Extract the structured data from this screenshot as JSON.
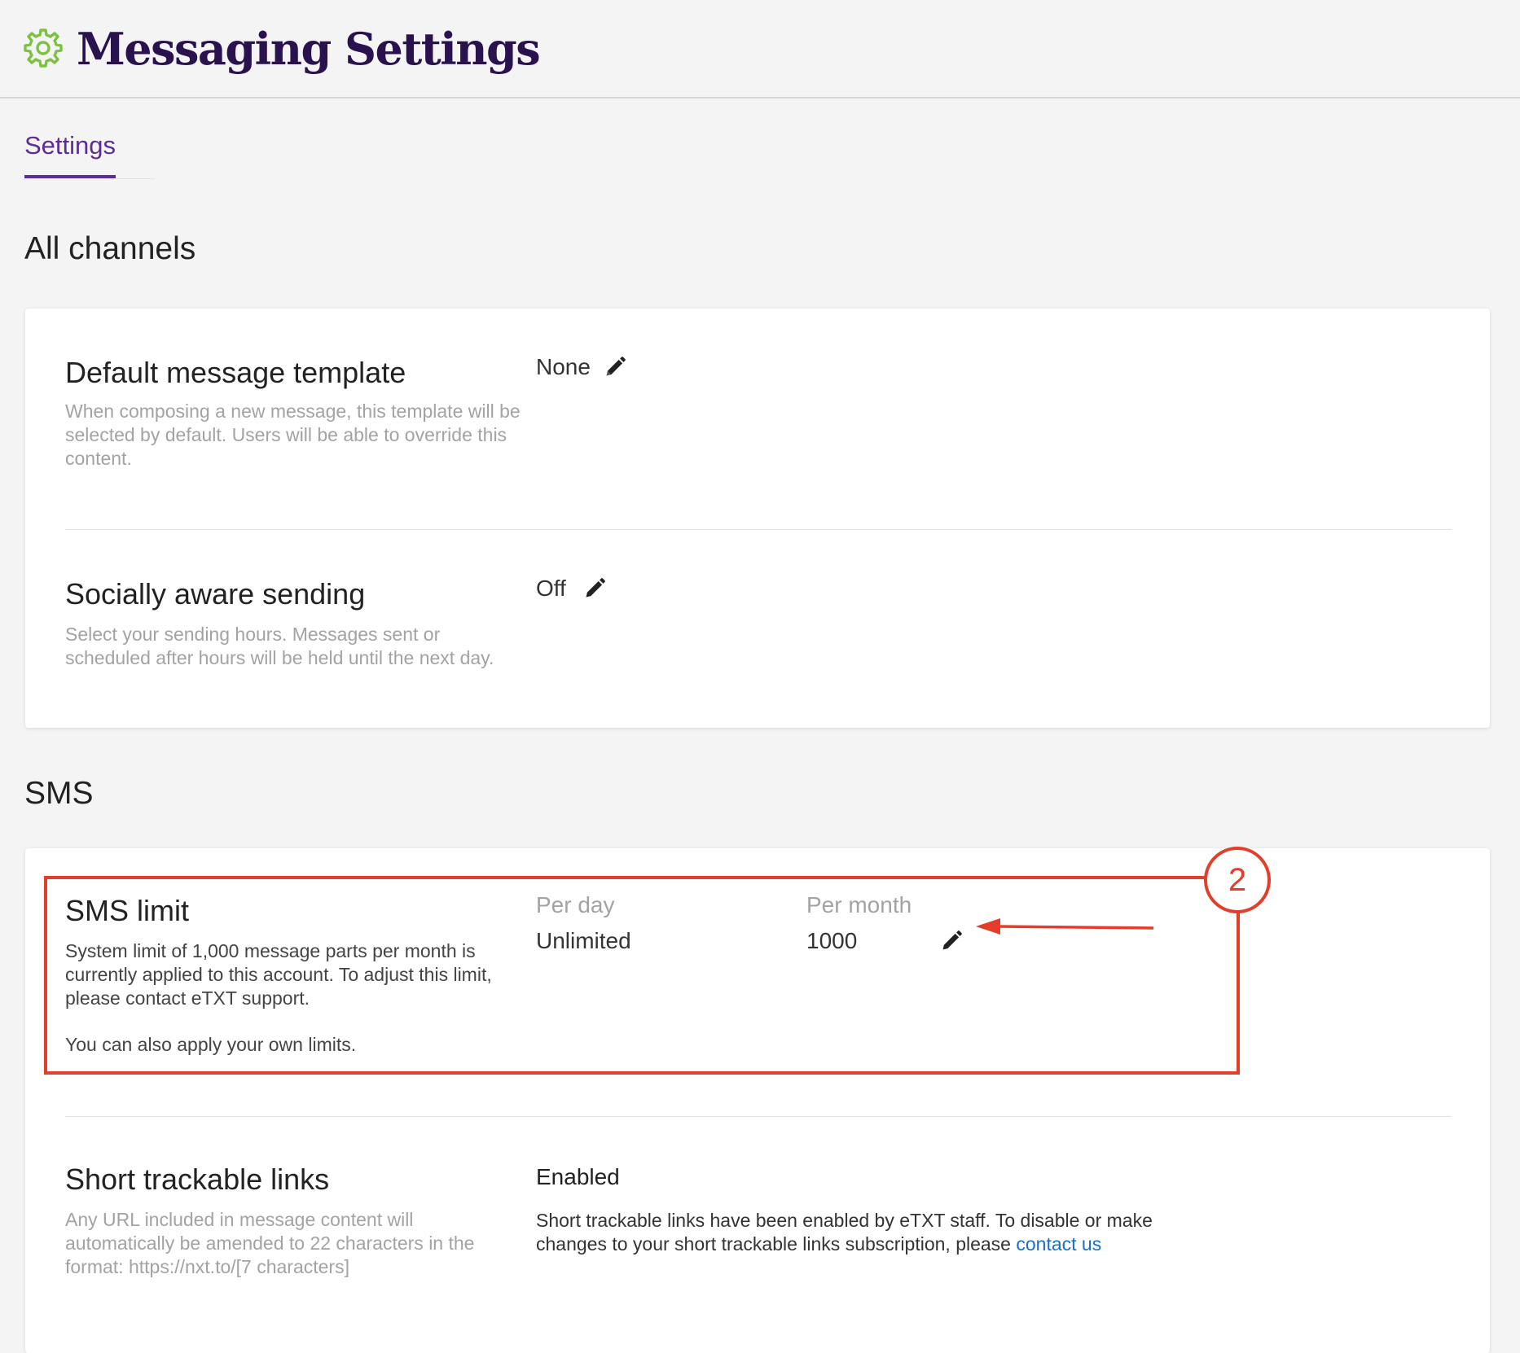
{
  "header": {
    "title": "Messaging Settings",
    "icon": "gear-icon"
  },
  "tabs": [
    {
      "label": "Settings",
      "active": true
    }
  ],
  "sections": {
    "all_channels": {
      "title": "All channels",
      "settings": {
        "default_template": {
          "title": "Default message template",
          "description": "When composing a new message, this template will be selected by default. Users will be able to override this content.",
          "value": "None"
        },
        "socially_aware": {
          "title": "Socially aware sending",
          "description": "Select your sending hours. Messages sent or scheduled after hours will be held until the next day.",
          "value": "Off"
        }
      }
    },
    "sms": {
      "title": "SMS",
      "settings": {
        "sms_limit": {
          "title": "SMS limit",
          "description": "System limit of 1,000 message parts per month is currently applied to this account. To adjust this limit, please contact eTXT support.",
          "description_extra": "You can also apply your own limits.",
          "per_day_label": "Per day",
          "per_day_value": "Unlimited",
          "per_month_label": "Per month",
          "per_month_value": "1000"
        },
        "short_links": {
          "title": "Short trackable links",
          "description": "Any URL included in message content will automatically be amended to 22 characters in the format: https://nxt.to/[7 characters]",
          "status": "Enabled",
          "note": "Short trackable links have been enabled by eTXT staff. To disable or make changes to your short trackable links subscription, please",
          "note_link": "contact us"
        }
      }
    }
  },
  "annotation": {
    "badge": "2"
  },
  "colors": {
    "title": "#2a124f",
    "accent": "#5c2d9a",
    "gear": "#7cc142",
    "annotation": "#e43e2b",
    "link": "#1a6ec8"
  }
}
